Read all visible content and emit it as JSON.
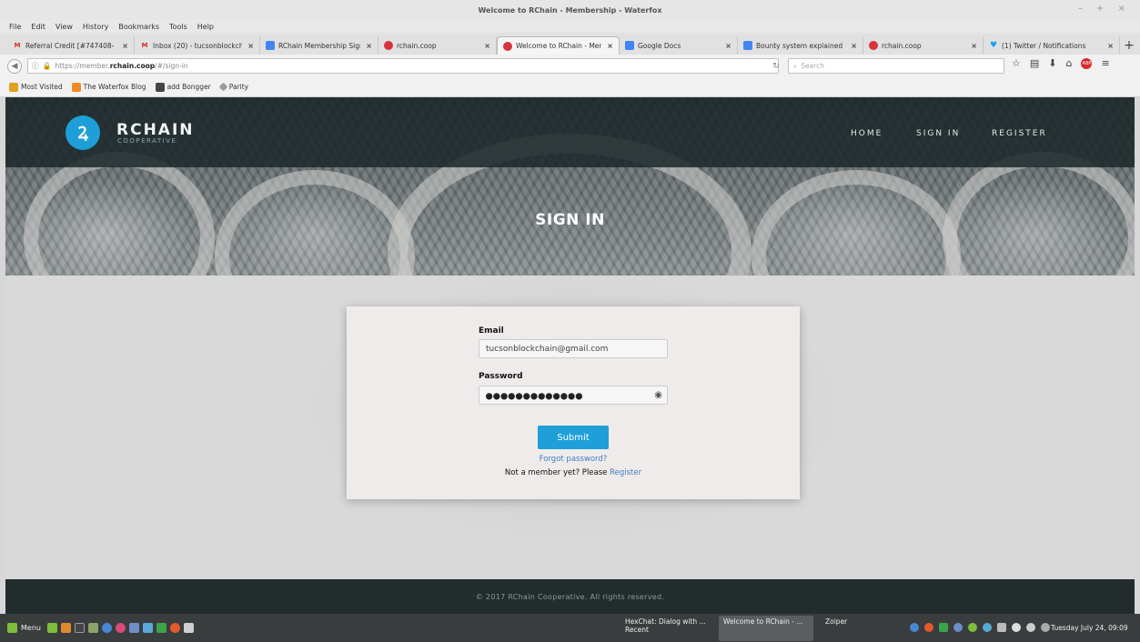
{
  "window": {
    "title": "Welcome to RChain - Membership - Waterfox",
    "controls": "– + ×"
  },
  "menu": [
    "File",
    "Edit",
    "View",
    "History",
    "Bookmarks",
    "Tools",
    "Help"
  ],
  "tabs": [
    {
      "label": "Referral Credit [#747408-",
      "icon": "gmail-icon",
      "color": "#d93025"
    },
    {
      "label": "Inbox (20) - tucsonblockch",
      "icon": "gmail-icon",
      "color": "#d93025"
    },
    {
      "label": "RChain Membership Sign",
      "icon": "docs-icon",
      "color": "#4285f4"
    },
    {
      "label": "rchain.coop",
      "icon": "rchain-favicon",
      "color": "#d8333d"
    },
    {
      "label": "Welcome to RChain - Mem",
      "icon": "rchain-favicon",
      "color": "#d8333d",
      "active": true
    },
    {
      "label": "Google Docs",
      "icon": "docs-icon",
      "color": "#4285f4"
    },
    {
      "label": "Bounty system explained",
      "icon": "docs-icon",
      "color": "#4285f4"
    },
    {
      "label": "rchain.coop",
      "icon": "rchain-favicon",
      "color": "#d8333d"
    },
    {
      "label": "(1) Twitter / Notifications",
      "icon": "twitter-icon",
      "color": "#1da1f2"
    }
  ],
  "url": {
    "prefix": "https://member.",
    "domain": "rchain.coop",
    "path": "/#/sign-in"
  },
  "search": {
    "placeholder": "Search"
  },
  "bookmarks": [
    "Most Visited",
    "The Waterfox Blog",
    "add Bongger",
    "Parity"
  ],
  "site": {
    "brand": "RCHAIN",
    "brand_sub": "COOPERATIVE",
    "nav": [
      "HOME",
      "SIGN IN",
      "REGISTER"
    ],
    "hero_title": "SIGN IN",
    "accent": "#1e9fd8",
    "form": {
      "email_label": "Email",
      "email_value": "tucsonblockchain@gmail.com",
      "password_label": "Password",
      "password_masked": "●●●●●●●●●●●●●",
      "submit_label": "Submit",
      "forgot_label": "Forgot password?",
      "member_text": "Not a member yet? Please",
      "register_link": "Register"
    },
    "footer": "© 2017 RChain Cooperative. All rights reserved."
  },
  "taskbar": {
    "menu_label": "Menu",
    "tasks": [
      {
        "label": "HexChat: Dialog with ..."
      },
      {
        "label": "Recent"
      },
      {
        "label": "Welcome to RChain - ..."
      },
      {
        "label": "Zoiper"
      }
    ],
    "clock": "Tuesday July 24, 09:09"
  }
}
